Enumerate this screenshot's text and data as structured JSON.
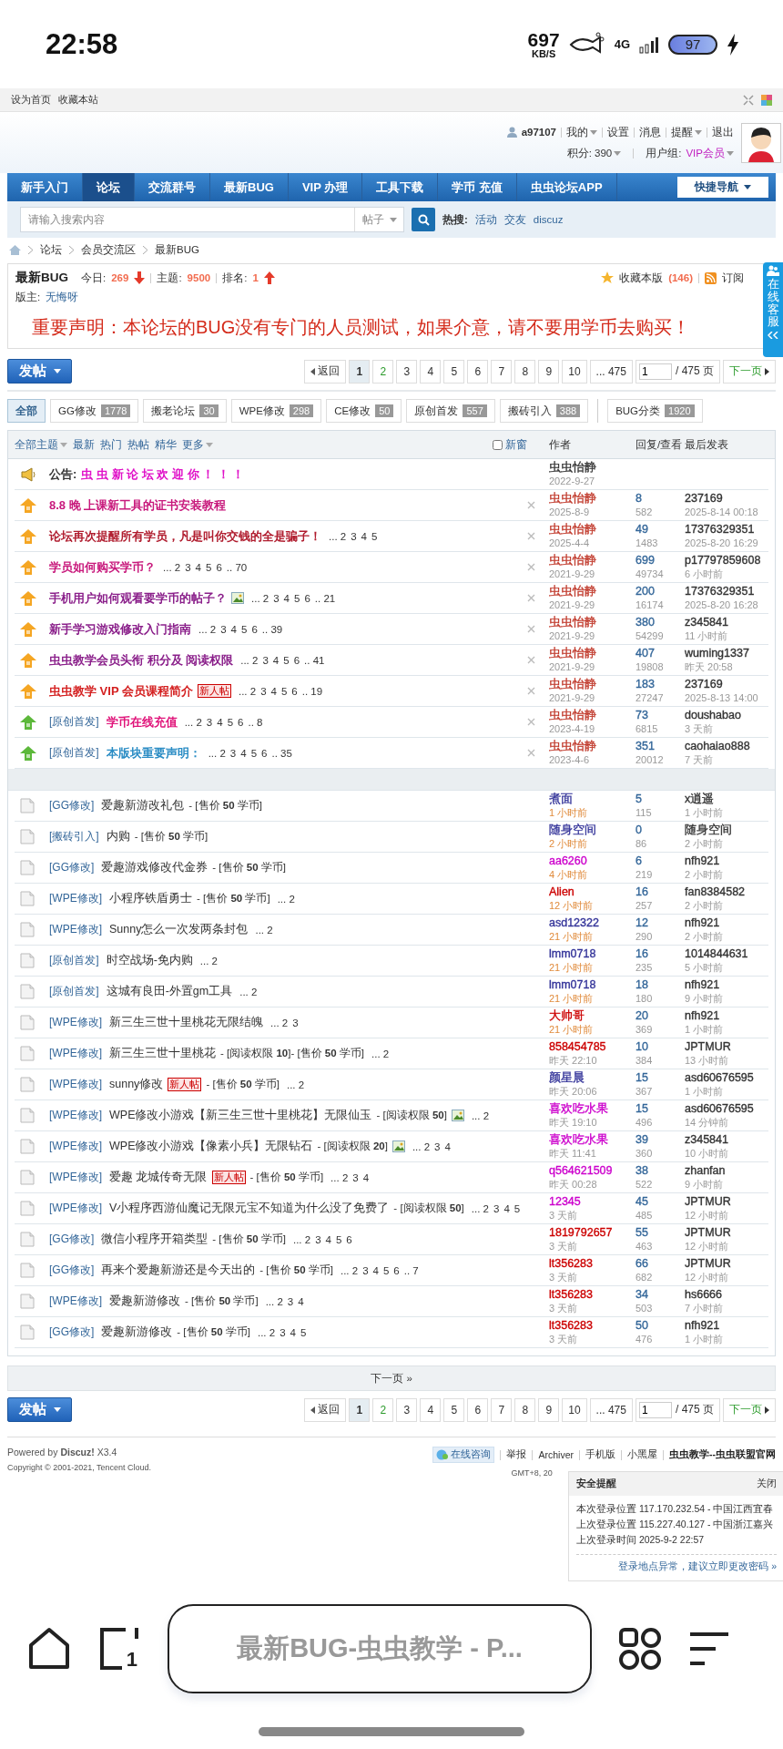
{
  "status_bar": {
    "time": "22:58",
    "speed": "697",
    "speed_unit": "KB/S",
    "network": "4G",
    "battery": "97"
  },
  "top_links": [
    "设为首页",
    "收藏本站"
  ],
  "user": {
    "name": "a97107",
    "links": [
      {
        "label": "我的",
        "dropdown": true
      },
      {
        "label": "设置",
        "dropdown": false
      },
      {
        "label": "消息",
        "dropdown": false
      },
      {
        "label": "提醒",
        "dropdown": true
      },
      {
        "label": "退出",
        "dropdown": false
      }
    ],
    "credits": "积分: 390",
    "group_label": "用户组:",
    "group": "VIP会员"
  },
  "nav": {
    "items": [
      {
        "label": "新手入门",
        "selected": false
      },
      {
        "label": "论坛",
        "selected": true
      },
      {
        "label": "交流群号",
        "selected": false
      },
      {
        "label": "最新BUG",
        "selected": false
      },
      {
        "label": "VIP 办理",
        "selected": false
      },
      {
        "label": "工具下载",
        "selected": false
      },
      {
        "label": "学币 充值",
        "selected": false
      },
      {
        "label": "虫虫论坛APP",
        "selected": false
      }
    ],
    "quick_nav": "快捷导航"
  },
  "search": {
    "placeholder": "请输入搜索内容",
    "type": "帖子",
    "hot_label": "热搜:",
    "hot": [
      "活动",
      "交友",
      "discuz"
    ]
  },
  "breadcrumb": [
    "论坛",
    "会员交流区",
    "最新BUG"
  ],
  "forum": {
    "title": "最新BUG",
    "today_label": "今日:",
    "today": "269",
    "today_rising": false,
    "topics_label": "主题:",
    "topics": "9500",
    "rank_label": "排名:",
    "rank": "1",
    "rank_rising": true,
    "favorite": "收藏本版",
    "favorite_count": "(146)",
    "subscribe": "订阅",
    "moderator_label": "版主:",
    "moderator": "无悔呀",
    "notice": "重要声明：本论坛的BUG没有专门的人员测试，如果介意，请不要用学币去购买！"
  },
  "side_tab": {
    "label": "在线客服"
  },
  "toolbar_top": {
    "post": "发帖",
    "back": "返回",
    "pages": [
      {
        "label": "1",
        "selected": true
      },
      {
        "label": "2",
        "selected": false
      },
      {
        "label": "3",
        "selected": false
      },
      {
        "label": "4",
        "selected": false
      },
      {
        "label": "5",
        "selected": false
      },
      {
        "label": "6",
        "selected": false
      },
      {
        "label": "7",
        "selected": false
      },
      {
        "label": "8",
        "selected": false
      },
      {
        "label": "9",
        "selected": false
      },
      {
        "label": "10",
        "selected": false
      }
    ],
    "last": "... 475",
    "input": "1",
    "total": "/ 475 页",
    "next": "下一页"
  },
  "filters": [
    {
      "label": "全部",
      "selected": true
    },
    {
      "label": "GG修改",
      "count": "1778",
      "selected": false
    },
    {
      "label": "搬老论坛",
      "count": "30",
      "selected": false
    },
    {
      "label": "WPE修改",
      "count": "298",
      "selected": false
    },
    {
      "label": "CE修改",
      "count": "50",
      "selected": false
    },
    {
      "label": "原创首发",
      "count": "557",
      "selected": false
    },
    {
      "label": "搬砖引入",
      "count": "388",
      "selected": false
    }
  ],
  "bug_category": {
    "label": "BUG分类",
    "count": "1920"
  },
  "table": {
    "header": {
      "filters": [
        {
          "label": "全部主题",
          "dropdown": true
        },
        {
          "label": "最新",
          "dropdown": false
        },
        {
          "label": "热门",
          "dropdown": false
        },
        {
          "label": "热帖",
          "dropdown": false
        },
        {
          "label": "精华",
          "dropdown": false
        },
        {
          "label": "更多",
          "dropdown": true
        }
      ],
      "new_window": {
        "label": "新窗",
        "checked": false
      },
      "author": "作者",
      "stats": "回复/查看",
      "last": "最后发表"
    },
    "sticky": [
      {
        "kind": "announcement",
        "label": "公告:",
        "title": "虫 虫 新 论 坛 欢 迎 你 ！ ！ ！",
        "color": "#e010c8",
        "author": {
          "name": "虫虫怡静",
          "color": "#333333"
        },
        "date": "2022-9-27"
      },
      {
        "kind": "global",
        "title": "8.8 晚 上课新工具的证书安装教程",
        "color": "#c8197c",
        "author": {
          "name": "虫虫怡静",
          "color": "#c0392b"
        },
        "date": "2025-8-9",
        "replies": "8",
        "views": "582",
        "last_user": "237169",
        "last_time": "2025-8-14 00:18"
      },
      {
        "kind": "global",
        "title": "论坛再次提醒所有学员，凡是叫你交钱的全是骗子！",
        "color": "#b01c2e",
        "pages": [
          "... 2",
          "3",
          "4",
          "5"
        ],
        "author": {
          "name": "虫虫怡静",
          "color": "#c0392b"
        },
        "date": "2025-4-4",
        "replies": "49",
        "views": "1483",
        "last_user": "17376329351",
        "last_time": "2025-8-20 16:29"
      },
      {
        "kind": "global",
        "title": "学员如何购买学币？",
        "color": "#c8197c",
        "pages": [
          "... 2",
          "3",
          "4",
          "5",
          "6",
          ".. 70"
        ],
        "author": {
          "name": "虫虫怡静",
          "color": "#c0392b"
        },
        "date": "2021-9-29",
        "replies": "699",
        "views": "49734",
        "last_user": "p17797859608",
        "last_time": "6 小时前"
      },
      {
        "kind": "global",
        "title": "手机用户如何观看要学币的帖子？",
        "color": "#8a1f8a",
        "attachment": true,
        "pages": [
          "... 2",
          "3",
          "4",
          "5",
          "6",
          ".. 21"
        ],
        "author": {
          "name": "虫虫怡静",
          "color": "#c0392b"
        },
        "date": "2021-9-29",
        "replies": "200",
        "views": "16174",
        "last_user": "17376329351",
        "last_time": "2025-8-20 16:28"
      },
      {
        "kind": "global",
        "title": "新手学习游戏修改入门指南",
        "color": "#8a1f8a",
        "pages": [
          "... 2",
          "3",
          "4",
          "5",
          "6",
          ".. 39"
        ],
        "author": {
          "name": "虫虫怡静",
          "color": "#c0392b"
        },
        "date": "2021-9-29",
        "replies": "380",
        "views": "54299",
        "last_user": "z345841",
        "last_time": "11 小时前"
      },
      {
        "kind": "global",
        "title": "虫虫教学会员头衔 积分及 阅读权限",
        "color": "#8a1f8a",
        "pages": [
          "... 2",
          "3",
          "4",
          "5",
          "6",
          ".. 41"
        ],
        "author": {
          "name": "虫虫怡静",
          "color": "#c0392b"
        },
        "date": "2021-9-29",
        "replies": "407",
        "views": "19808",
        "last_user": "wuming1337",
        "last_time": "昨天 20:58"
      },
      {
        "kind": "global",
        "title": "虫虫教学 VIP 会员课程简介",
        "color": "#d42020",
        "badge": "新人帖",
        "pages": [
          "... 2",
          "3",
          "4",
          "5",
          "6",
          ".. 19"
        ],
        "author": {
          "name": "虫虫怡静",
          "color": "#c0392b"
        },
        "date": "2021-9-29",
        "replies": "183",
        "views": "27247",
        "last_user": "237169",
        "last_time": "2025-8-13 14:00"
      },
      {
        "kind": "forum",
        "category": "[原创首发]",
        "title": "学币在线充值",
        "color": "#e0147a",
        "pages": [
          "... 2",
          "3",
          "4",
          "5",
          "6",
          ".. 8"
        ],
        "author": {
          "name": "虫虫怡静",
          "color": "#c0392b"
        },
        "date": "2023-4-19",
        "replies": "73",
        "views": "6815",
        "last_user": "doushabao",
        "last_time": "3 天前"
      },
      {
        "kind": "forum",
        "category": "[原创首发]",
        "title": "本版块重要声明：",
        "color": "#2a8cc4",
        "pages": [
          "... 2",
          "3",
          "4",
          "5",
          "6",
          ".. 35"
        ],
        "author": {
          "name": "虫虫怡静",
          "color": "#c0392b"
        },
        "date": "2023-4-6",
        "replies": "351",
        "views": "20012",
        "last_user": "caohaiao888",
        "last_time": "7 天前"
      }
    ],
    "threads": [
      {
        "category": "[GG修改]",
        "title": "爱趣新游改礼包",
        "extra": "- [售价 **50** 学币]",
        "author": {
          "name": "煮面",
          "color": "#333399"
        },
        "date": "1 小时前",
        "recent": true,
        "replies": "5",
        "views": "115",
        "last_user": "x逍遥",
        "last_time": "1 小时前"
      },
      {
        "category": "[搬砖引入]",
        "title": "内购",
        "extra": "- [售价 **50** 学币]",
        "author": {
          "name": "随身空间",
          "color": "#333399"
        },
        "date": "2 小时前",
        "recent": true,
        "replies": "0",
        "views": "86",
        "last_user": "随身空间",
        "last_time": "2 小时前"
      },
      {
        "category": "[GG修改]",
        "title": "爱趣游戏修改代金券",
        "extra": "- [售价 **50** 学币]",
        "author": {
          "name": "aa6260",
          "color": "#cc00cc"
        },
        "date": "4 小时前",
        "recent": true,
        "replies": "6",
        "views": "219",
        "last_user": "nfh921",
        "last_time": "2 小时前"
      },
      {
        "category": "[WPE修改]",
        "title": "小程序铁盾勇士",
        "extra": "- [售价 **50** 学币]",
        "pages": [
          "... 2"
        ],
        "author": {
          "name": "Alien",
          "color": "#cc0000"
        },
        "date": "12 小时前",
        "recent": true,
        "replies": "16",
        "views": "257",
        "last_user": "fan8384582",
        "last_time": "2 小时前"
      },
      {
        "category": "[WPE修改]",
        "title": "Sunny怎么一次发两条封包",
        "pages": [
          "... 2"
        ],
        "author": {
          "name": "asd12322",
          "color": "#333399"
        },
        "date": "21 小时前",
        "recent": true,
        "replies": "12",
        "views": "290",
        "last_user": "nfh921",
        "last_time": "2 小时前"
      },
      {
        "category": "[原创首发]",
        "title": "时空战场-免内购",
        "pages": [
          "... 2"
        ],
        "author": {
          "name": "lmm0718",
          "color": "#333399"
        },
        "date": "21 小时前",
        "recent": true,
        "replies": "16",
        "views": "235",
        "last_user": "1014844631",
        "last_time": "5 小时前"
      },
      {
        "category": "[原创首发]",
        "title": "这城有良田-外置gm工具",
        "pages": [
          "... 2"
        ],
        "author": {
          "name": "lmm0718",
          "color": "#333399"
        },
        "date": "21 小时前",
        "recent": true,
        "replies": "18",
        "views": "180",
        "last_user": "nfh921",
        "last_time": "9 小时前"
      },
      {
        "category": "[WPE修改]",
        "title": "新三生三世十里桃花无限结魄",
        "pages": [
          "... 2",
          "3"
        ],
        "author": {
          "name": "大帅哥",
          "color": "#cc0000"
        },
        "date": "21 小时前",
        "recent": true,
        "replies": "20",
        "views": "369",
        "last_user": "nfh921",
        "last_time": "1 小时前"
      },
      {
        "category": "[WPE修改]",
        "title": "新三生三世十里桃花",
        "extra": "- [阅读权限 **10**]- [售价 **50** 学币]",
        "pages": [
          "... 2"
        ],
        "author": {
          "name": "858454785",
          "color": "#cc0000"
        },
        "date": "昨天 22:10",
        "recent": false,
        "replies": "10",
        "views": "384",
        "last_user": "JPTMUR",
        "last_time": "13 小时前"
      },
      {
        "category": "[WPE修改]",
        "title": "sunny修改",
        "badge": "新人帖",
        "extra": "- [售价 **50** 学币]",
        "pages": [
          "... 2"
        ],
        "author": {
          "name": "颜星晨",
          "color": "#333399"
        },
        "date": "昨天 20:06",
        "recent": false,
        "replies": "15",
        "views": "367",
        "last_user": "asd60676595",
        "last_time": "1 小时前"
      },
      {
        "category": "[WPE修改]",
        "title": "WPE修改小游戏【新三生三世十里桃花】无限仙玉",
        "extra": "- [阅读权限 **50**]",
        "attachment": true,
        "pages": [
          "... 2"
        ],
        "author": {
          "name": "喜欢吃水果",
          "color": "#cc00cc"
        },
        "date": "昨天 19:10",
        "recent": false,
        "replies": "15",
        "views": "496",
        "last_user": "asd60676595",
        "last_time": "14 分钟前"
      },
      {
        "category": "[WPE修改]",
        "title": "WPE修改小游戏【像素小兵】无限钻石",
        "extra": "- [阅读权限 **20**]",
        "attachment": true,
        "pages": [
          "... 2",
          "3",
          "4"
        ],
        "author": {
          "name": "喜欢吃水果",
          "color": "#cc00cc"
        },
        "date": "昨天 11:41",
        "recent": false,
        "replies": "39",
        "views": "360",
        "last_user": "z345841",
        "last_time": "10 小时前"
      },
      {
        "category": "[WPE修改]",
        "title": "爱趣 龙城传奇无限",
        "badge": "新人帖",
        "extra": "- [售价 **50** 学币]",
        "pages": [
          "... 2",
          "3",
          "4"
        ],
        "author": {
          "name": "q564621509",
          "color": "#cc00cc"
        },
        "date": "昨天 00:28",
        "recent": false,
        "replies": "38",
        "views": "522",
        "last_user": "zhanfan",
        "last_time": "9 小时前"
      },
      {
        "category": "[WPE修改]",
        "title": "V小程序西游仙魔记无限元宝不知道为什么没了免费了",
        "extra": "- [阅读权限 **50**]",
        "pages": [
          "... 2",
          "3",
          "4",
          "5"
        ],
        "author": {
          "name": "12345",
          "color": "#cc00cc"
        },
        "date": "3 天前",
        "recent": false,
        "replies": "45",
        "views": "485",
        "last_user": "JPTMUR",
        "last_time": "12 小时前"
      },
      {
        "category": "[GG修改]",
        "title": "微信小程序开箱类型",
        "extra": "- [售价 **50** 学币]",
        "pages": [
          "... 2",
          "3",
          "4",
          "5",
          "6"
        ],
        "author": {
          "name": "1819792657",
          "color": "#cc0000"
        },
        "date": "3 天前",
        "recent": false,
        "replies": "55",
        "views": "463",
        "last_user": "JPTMUR",
        "last_time": "12 小时前"
      },
      {
        "category": "[GG修改]",
        "title": "再来个爱趣新游还是今天出的",
        "extra": "- [售价 **50** 学币]",
        "pages": [
          "... 2",
          "3",
          "4",
          "5",
          "6",
          ".. 7"
        ],
        "author": {
          "name": "lt356283",
          "color": "#cc0000"
        },
        "date": "3 天前",
        "recent": false,
        "replies": "66",
        "views": "682",
        "last_user": "JPTMUR",
        "last_time": "12 小时前"
      },
      {
        "category": "[WPE修改]",
        "title": "爱趣新游修改",
        "extra": "- [售价 **50** 学币]",
        "pages": [
          "... 2",
          "3",
          "4"
        ],
        "author": {
          "name": "lt356283",
          "color": "#cc0000"
        },
        "date": "3 天前",
        "recent": false,
        "replies": "34",
        "views": "503",
        "last_user": "hs6666",
        "last_time": "7 小时前"
      },
      {
        "category": "[GG修改]",
        "title": "爱趣新游修改",
        "extra": "- [售价 **50** 学币]",
        "pages": [
          "... 2",
          "3",
          "4",
          "5"
        ],
        "author": {
          "name": "lt356283",
          "color": "#cc0000"
        },
        "date": "3 天前",
        "recent": false,
        "replies": "50",
        "views": "476",
        "last_user": "nfh921",
        "last_time": "1 小时前"
      }
    ],
    "next_page": "下一页 »"
  },
  "toolbar_bottom": {
    "post": "发帖",
    "back": "返回",
    "pages": [
      {
        "label": "1",
        "selected": true
      },
      {
        "label": "2",
        "selected": false
      },
      {
        "label": "3",
        "selected": false
      },
      {
        "label": "4",
        "selected": false
      },
      {
        "label": "5",
        "selected": false
      },
      {
        "label": "6",
        "selected": false
      },
      {
        "label": "7",
        "selected": false
      },
      {
        "label": "8",
        "selected": false
      },
      {
        "label": "9",
        "selected": false
      },
      {
        "label": "10",
        "selected": false
      }
    ],
    "last": "... 475",
    "input": "1",
    "total": "/ 475 页",
    "next": "下一页"
  },
  "footer": {
    "powered": "Powered by **Discuz!** X3.4",
    "copyright": "Copyright © 2001-2021, Tencent Cloud.",
    "consult": "在线咨询",
    "links": [
      "举报",
      "Archiver",
      "手机版",
      "小黑屋"
    ],
    "site": "虫虫教学--虫虫联盟官网",
    "gmt": "GMT+8, 20"
  },
  "security": {
    "title": "安全提醒",
    "close": "关闭",
    "lines": [
      "本次登录位置 117.170.232.54 - 中国江西宜春",
      "上次登录位置 115.227.40.127 - 中国浙江嘉兴",
      "上次登录时间 2025-9-2 22:57"
    ],
    "link": "登录地点异常，建议立即更改密码 »"
  },
  "browser": {
    "tab_count": "1",
    "title": "最新BUG-虫虫教学 - P..."
  }
}
